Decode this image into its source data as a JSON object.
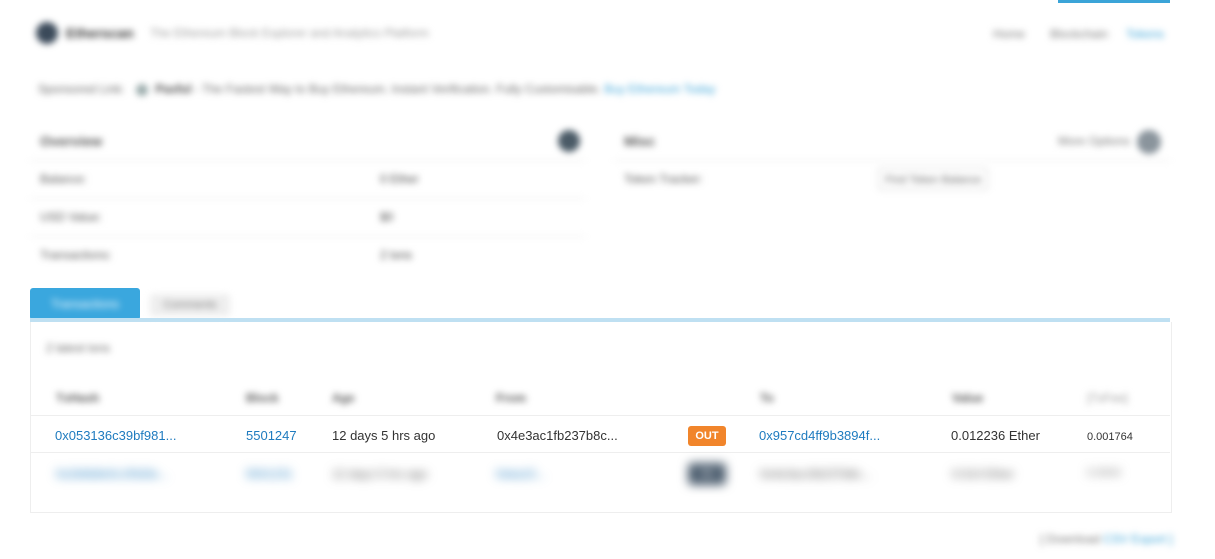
{
  "header": {
    "brand": "Etherscan",
    "tagline": "The Ethereum Block Explorer and Analytics Platform",
    "nav": [
      "Home",
      "Blockchain",
      "Tokens"
    ],
    "accent_color": "#3ba4d8"
  },
  "sponsored": {
    "label": "Sponsored Link:",
    "name": "Paxful",
    "text": "- The Fastest Way to Buy Ethereum. Instant Verification. Fully Customisable.",
    "link": "Buy Ethereum Today"
  },
  "overview": {
    "title": "Overview",
    "rows": [
      {
        "label": "Balance:",
        "value": "0 Ether"
      },
      {
        "label": "USD Value:",
        "value": "$0"
      },
      {
        "label": "Transactions:",
        "value": "2 txns"
      }
    ]
  },
  "misc": {
    "title": "Misc",
    "more_options": "More Options",
    "token_tracker_label": "Token Tracker:",
    "token_select": "Find Token Balance"
  },
  "tabs": [
    "Transactions",
    "Comments"
  ],
  "table": {
    "latest": "2 latest txns",
    "headers": [
      "TxHash",
      "Block",
      "Age",
      "From",
      "To",
      "Value",
      "[TxFee]"
    ],
    "rows": [
      {
        "txhash": "0x053136c39bf981...",
        "block": "5501247",
        "age": "12 days 5 hrs ago",
        "from": "0x4e3ac1fb237b8c...",
        "direction": "OUT",
        "to": "0x957cd4ff9b3894f...",
        "value": "0.012236 Ether",
        "fee": "0.001764"
      },
      {
        "txhash": "0x2b6b8e5c1f0d3e...",
        "block": "5501231",
        "age": "12 days 5 hrs ago",
        "from": "0xba10...",
        "direction": "IN",
        "to": "0x4e3ac1fb237b8c...",
        "value": "0.014 Ether",
        "fee": "0.0004"
      }
    ],
    "out_color": "#f1852b"
  },
  "footer": {
    "prefix": "[ Download ",
    "link": "CSV Export ]"
  }
}
